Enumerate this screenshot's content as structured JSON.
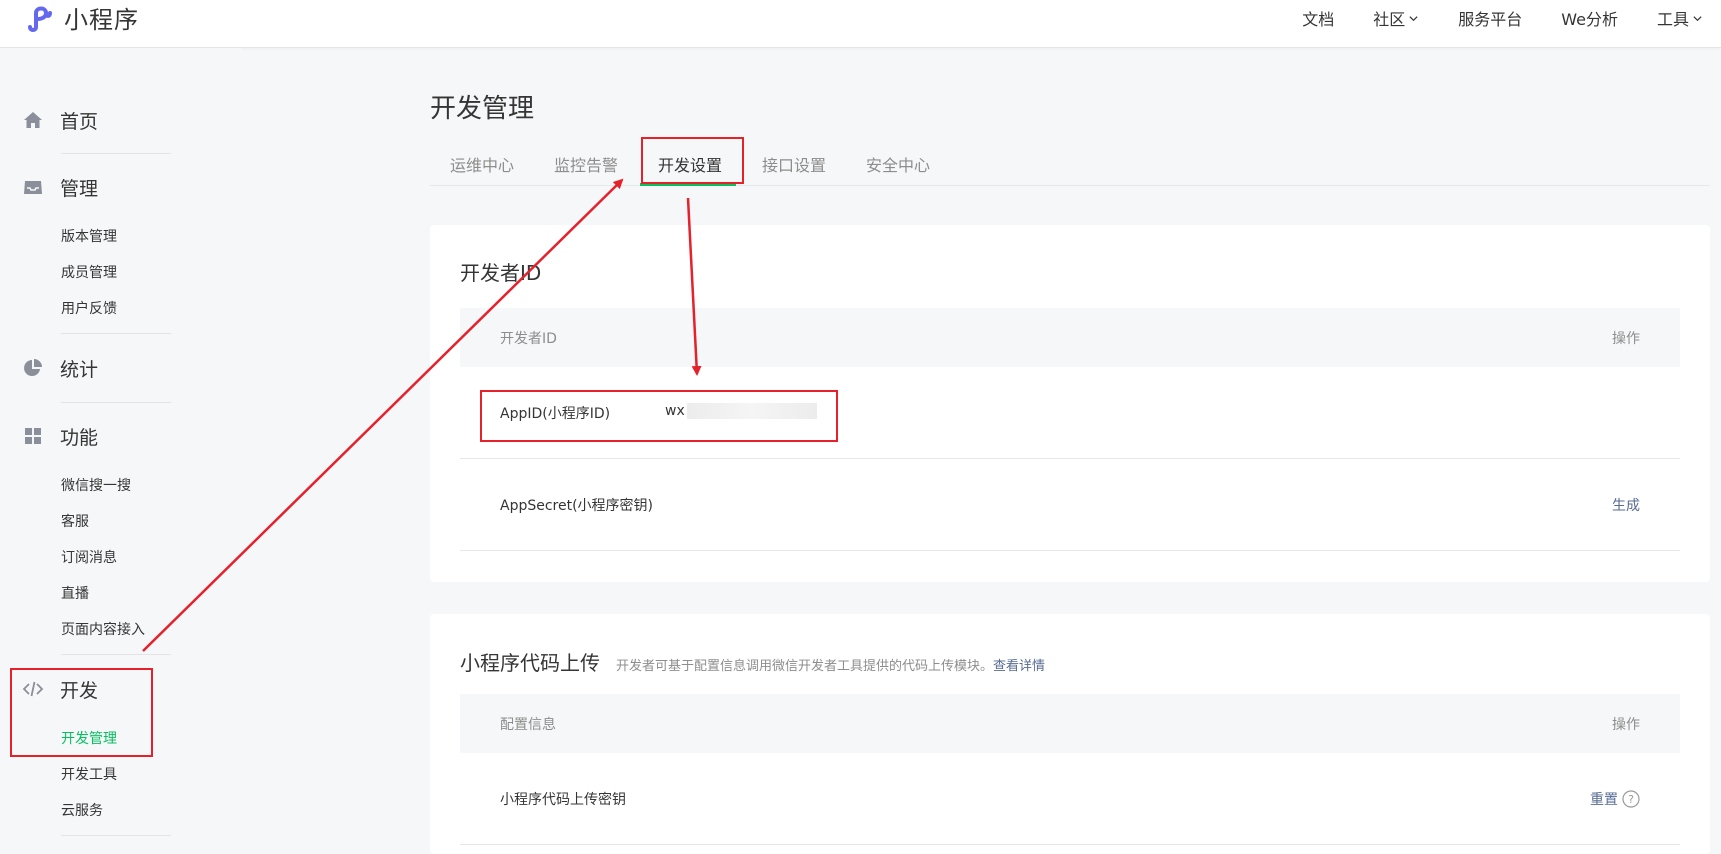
{
  "brand": {
    "name": "小程序"
  },
  "topnav": {
    "items": [
      {
        "label": "文档",
        "has_dropdown": false
      },
      {
        "label": "社区",
        "has_dropdown": true
      },
      {
        "label": "服务平台",
        "has_dropdown": false
      },
      {
        "label": "We分析",
        "has_dropdown": false
      },
      {
        "label": "工具",
        "has_dropdown": true
      }
    ]
  },
  "sidebar": {
    "home": {
      "label": "首页",
      "icon": "home-icon"
    },
    "manage": {
      "label": "管理",
      "icon": "inbox-icon",
      "items": [
        "版本管理",
        "成员管理",
        "用户反馈"
      ]
    },
    "stats": {
      "label": "统计",
      "icon": "pie-chart-icon"
    },
    "features": {
      "label": "功能",
      "icon": "grid-icon",
      "items": [
        "微信搜一搜",
        "客服",
        "订阅消息",
        "直播",
        "页面内容接入"
      ]
    },
    "dev": {
      "label": "开发",
      "icon": "code-icon",
      "items": [
        "开发管理",
        "开发工具",
        "云服务"
      ],
      "active_item": "开发管理"
    }
  },
  "page": {
    "title": "开发管理",
    "tabs": [
      "运维中心",
      "监控告警",
      "开发设置",
      "接口设置",
      "安全中心"
    ],
    "active_tab": "开发设置"
  },
  "developer_id": {
    "title": "开发者ID",
    "columns": [
      "开发者ID",
      "操作"
    ],
    "rows": [
      {
        "label": "AppID(小程序ID)",
        "value": "wx",
        "action": ""
      },
      {
        "label": "AppSecret(小程序密钥)",
        "value": "",
        "action": "生成"
      }
    ]
  },
  "code_upload": {
    "title": "小程序代码上传",
    "description": "开发者可基于配置信息调用微信开发者工具提供的代码上传模块。",
    "link": "查看详情",
    "columns": [
      "配置信息",
      "操作"
    ],
    "rows": [
      {
        "label": "小程序代码上传密钥",
        "action": "重置",
        "help": "?"
      }
    ]
  },
  "colors": {
    "accent": "#07c160",
    "link": "#576b95",
    "annotation": "#e5212c"
  }
}
